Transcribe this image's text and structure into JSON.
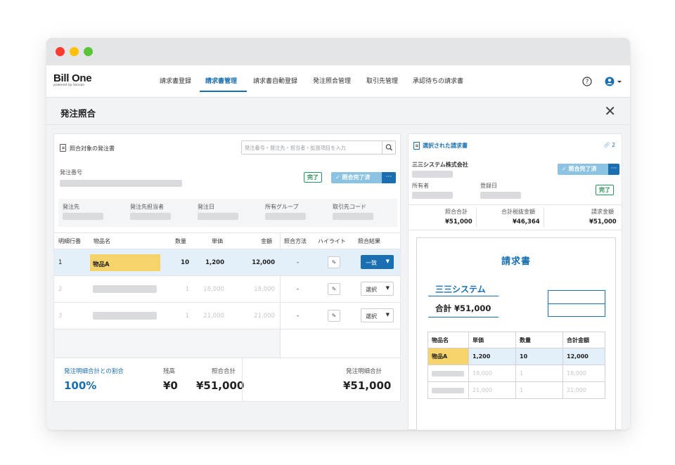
{
  "window": {
    "traffic_lights": [
      "close",
      "minimize",
      "zoom"
    ]
  },
  "brand": {
    "logo_main": "Bill One",
    "logo_sub": "powered by Sansan"
  },
  "nav": {
    "items": [
      {
        "label": "請求書登録",
        "active": false
      },
      {
        "label": "請求書管理",
        "active": true
      },
      {
        "label": "請求書自動登録",
        "active": false
      },
      {
        "label": "発注照合管理",
        "active": false
      },
      {
        "label": "取引先管理",
        "active": false
      },
      {
        "label": "承認待ちの請求書",
        "active": false
      }
    ],
    "help_icon": "help-circle-icon",
    "user_icon": "user-circle-icon"
  },
  "page": {
    "title": "発注照合",
    "close_icon": "close-icon"
  },
  "left": {
    "section_title": "照合対象の発注書",
    "search_placeholder": "発注番号・発注先・担当者・拡張項目を入力",
    "po_number_label": "発注番号",
    "status_done": "完了",
    "status_match": "✓ 照合完了済",
    "more": "···",
    "info_labels": [
      "発注先",
      "発注先担当者",
      "発注日",
      "所有グループ",
      "取引先コード"
    ],
    "table": {
      "headers": [
        "明細行番",
        "物品名",
        "数量",
        "単価",
        "金額",
        "照合方法",
        "ハイライト",
        "照合結果"
      ],
      "rows": [
        {
          "no": "1",
          "item": "物品A",
          "qty": "10",
          "price": "1,200",
          "amount": "12,000",
          "method": "-",
          "result": "一致",
          "highlighted": true
        },
        {
          "no": "2",
          "item": "",
          "qty": "1",
          "price": "18,000",
          "amount": "18,000",
          "method": "-",
          "result": "選択",
          "highlighted": false
        },
        {
          "no": "3",
          "item": "",
          "qty": "1",
          "price": "21,000",
          "amount": "21,000",
          "method": "-",
          "result": "選択",
          "highlighted": false
        }
      ]
    },
    "summary": {
      "ratio_label": "発注明細合計との割合",
      "ratio_value": "100%",
      "balance_label": "残高",
      "balance_value": "¥0",
      "match_total_label": "照合合計",
      "match_total_value": "¥51,000",
      "po_total_label": "発注明細合計",
      "po_total_value": "¥51,000"
    }
  },
  "right": {
    "section_title": "選択された請求書",
    "link_count": "2",
    "company": "三三システム株式会社",
    "status_match": "✓ 照合完了済",
    "more": "···",
    "owner_label": "所有者",
    "reg_date_label": "登録日",
    "status_done": "完了",
    "totals": [
      {
        "label": "照合合計",
        "value": "¥51,000"
      },
      {
        "label": "合計税抜金額",
        "value": "¥46,364"
      },
      {
        "label": "請求金額",
        "value": "¥51,000"
      }
    ],
    "document": {
      "title": "請求書",
      "company": "三三システム",
      "total": "合計 ¥51,000",
      "headers": [
        "物品名",
        "単価",
        "数量",
        "合計金額"
      ],
      "rows": [
        {
          "item": "物品A",
          "price": "1,200",
          "qty": "10",
          "amount": "12,000",
          "highlighted": true
        },
        {
          "item": "",
          "price": "18,000",
          "qty": "1",
          "amount": "18,000",
          "highlighted": false
        },
        {
          "item": "",
          "price": "21,000",
          "qty": "1",
          "amount": "21,000",
          "highlighted": false
        }
      ]
    }
  },
  "colors": {
    "accent": "#1a6fb0",
    "highlight_yellow": "#f7d36b",
    "row_blue": "#e3f0f9",
    "done_green": "#1f8a50"
  }
}
